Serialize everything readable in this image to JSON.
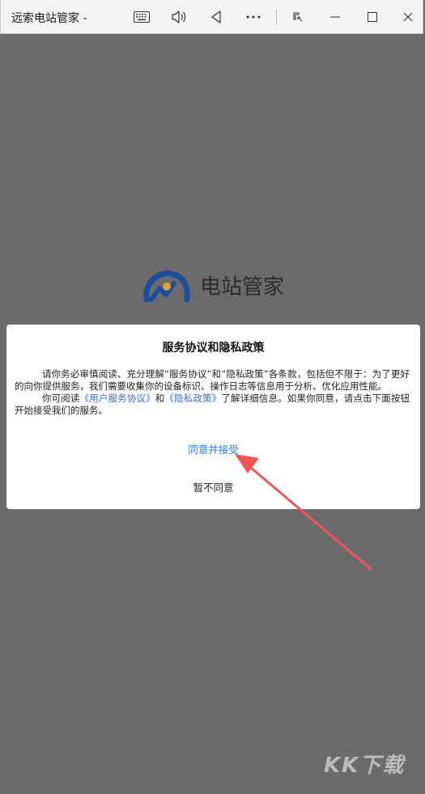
{
  "window": {
    "title": "远索电站管家 -"
  },
  "app": {
    "logo_text": "电站管家"
  },
  "dialog": {
    "title": "服务协议和隐私政策",
    "para1": "请你务必审慎阅读、充分理解“服务协议”和“隐私政策”各条款，包括但不限于：为了更好的向你提供服务，我们需要收集你的设备标识、操作日志等信息用于分析、优化应用性能。",
    "para2_prefix": "你可阅读",
    "user_agreement_link": "《用户服务协议》",
    "para2_and": "和",
    "privacy_link": "《隐私政策》",
    "para2_suffix": "了解详细信息。如果你同意，请点击下面按钮开始接受我们的服务。",
    "agree_label": "同意并接受",
    "disagree_label": "暂不同意"
  },
  "watermark": {
    "text": "KK下载"
  },
  "colors": {
    "backdrop": "#6b6b6b",
    "link": "#2f7ee0",
    "arrow": "#f05555",
    "logo_blue": "#1d4e9e",
    "logo_gold": "#d9a43a"
  }
}
